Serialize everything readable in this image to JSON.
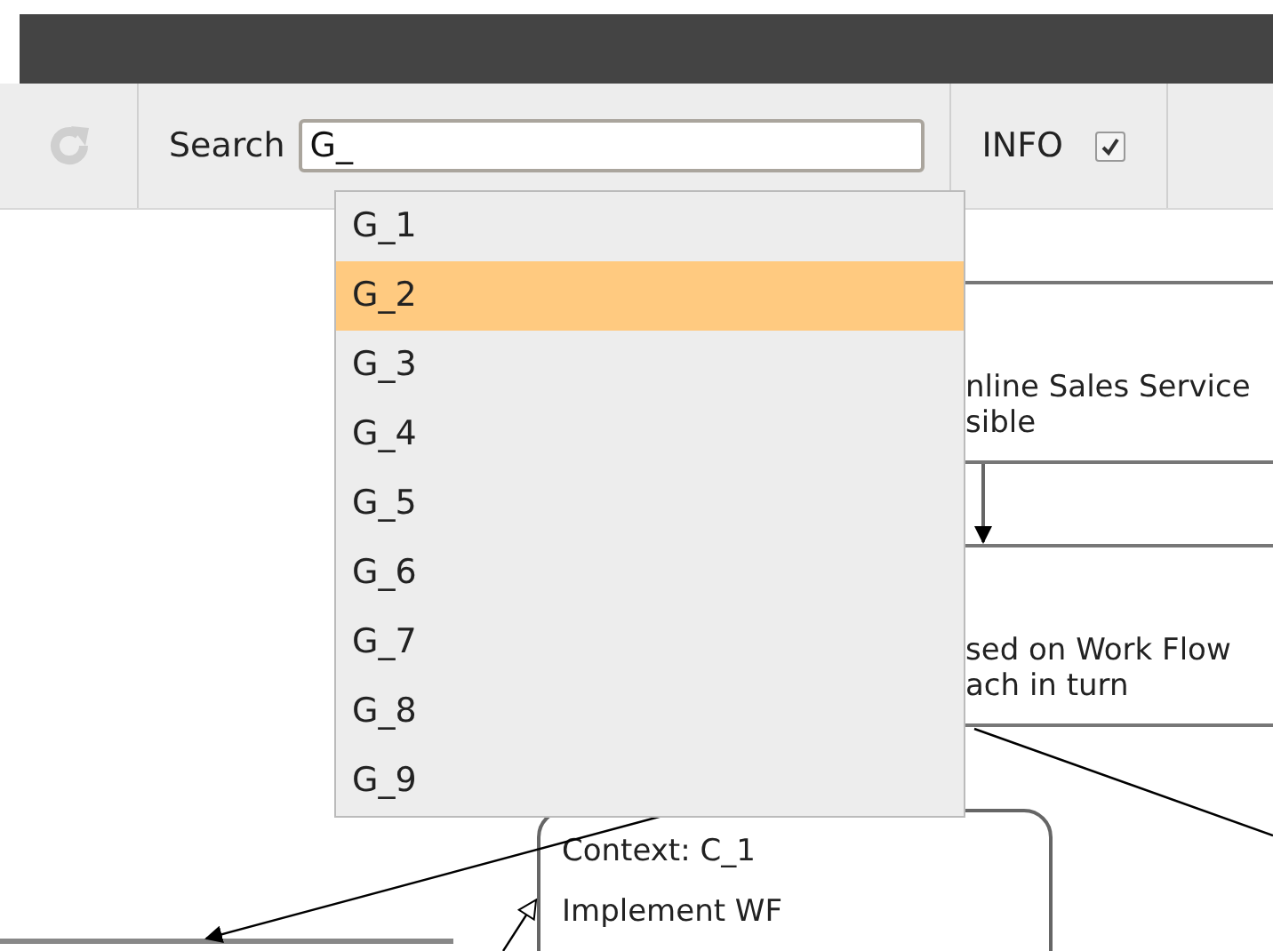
{
  "toolbar": {
    "search_label": "Search",
    "search_value": "G_",
    "info_label": "INFO",
    "info_checked": true
  },
  "dropdown": {
    "items": [
      {
        "label": "G_1",
        "selected": false
      },
      {
        "label": "G_2",
        "selected": true
      },
      {
        "label": "G_3",
        "selected": false
      },
      {
        "label": "G_4",
        "selected": false
      },
      {
        "label": "G_5",
        "selected": false
      },
      {
        "label": "G_6",
        "selected": false
      },
      {
        "label": "G_7",
        "selected": false
      },
      {
        "label": "G_8",
        "selected": false
      },
      {
        "label": "G_9",
        "selected": false
      }
    ]
  },
  "diagram": {
    "nodes": [
      {
        "kind": "goal",
        "lines": [
          "nline Sales Service",
          "sible"
        ]
      },
      {
        "kind": "strategy",
        "lines": [
          "sed on Work Flow",
          "ach in turn"
        ]
      },
      {
        "kind": "context",
        "lines": [
          "Context: C_1",
          "Implement WF"
        ]
      }
    ]
  }
}
